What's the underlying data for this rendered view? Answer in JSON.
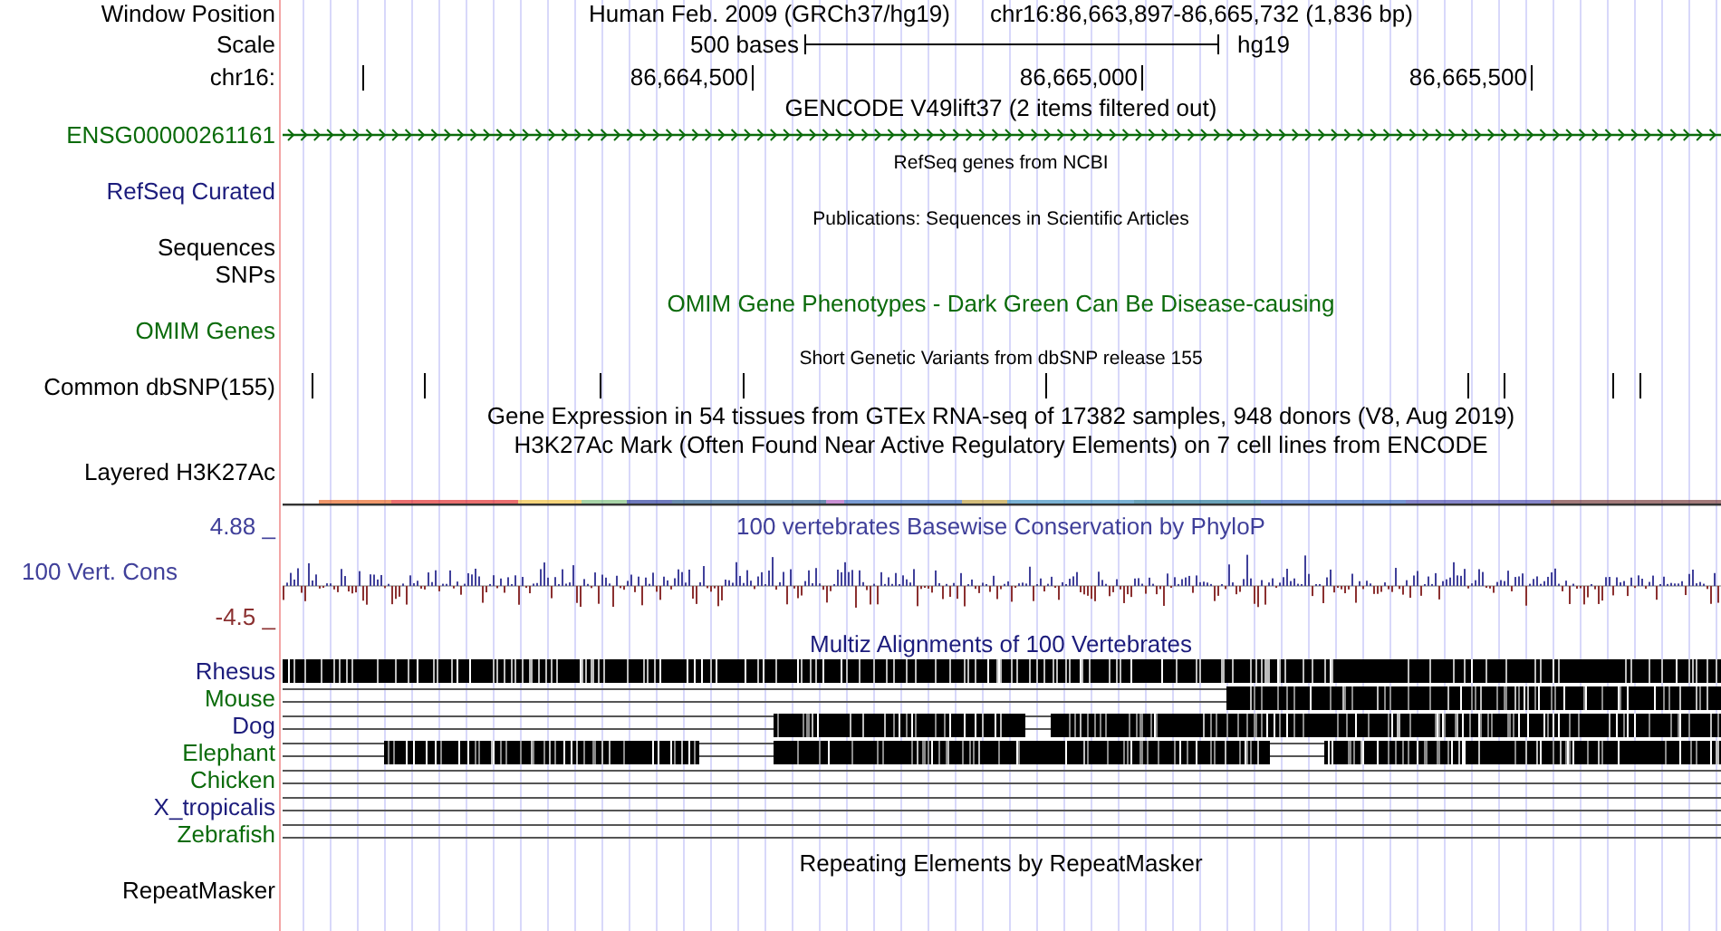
{
  "position": {
    "label": "Window Position",
    "assembly": "Human Feb. 2009 (GRCh37/hg19)",
    "range": "chr16:86,663,897-86,665,732 (1,836 bp)"
  },
  "scale": {
    "label": "Scale",
    "length": "500 bases",
    "assembly": "hg19"
  },
  "ruler": {
    "label": "chr16:",
    "ticks": [
      "86,664,500",
      "86,665,000",
      "86,665,500"
    ]
  },
  "tracks": [
    {
      "kind": "gene",
      "small": false,
      "title": "GENCODE V49lift37 (2 items filtered out)",
      "color": "#000000",
      "items": [
        {
          "name": "ENSG00000261161",
          "color": "#0b6b0b"
        }
      ]
    },
    {
      "kind": "empty",
      "small": true,
      "title": "RefSeq genes from NCBI",
      "color": "#000000",
      "labels": [
        {
          "text": "RefSeq Curated",
          "color": "#1c1c7c"
        }
      ]
    },
    {
      "kind": "empty",
      "small": true,
      "title": "Publications: Sequences in Scientific Articles",
      "color": "#000000",
      "labels": [
        {
          "text": "Sequences",
          "color": "#000000"
        },
        {
          "text": "SNPs",
          "color": "#000000"
        }
      ]
    },
    {
      "kind": "empty",
      "small": false,
      "title": "OMIM Gene Phenotypes - Dark Green Can Be Disease-causing",
      "color": "#0b6b0b",
      "labels": [
        {
          "text": "OMIM Genes",
          "color": "#0b6b0b"
        }
      ]
    },
    {
      "kind": "snp",
      "small": true,
      "title": "Short Genetic Variants from dbSNP release 155",
      "color": "#000000",
      "labels": [
        {
          "text": "Common dbSNP(155)",
          "color": "#000000"
        }
      ]
    },
    {
      "kind": "empty",
      "small": false,
      "title": "Gene Expression in 54 tissues from GTEx RNA-seq of 17382 samples, 948 donors (V8, Aug 2019)",
      "color": "#000000"
    },
    {
      "kind": "layered",
      "small": false,
      "title": "H3K27Ac Mark (Often Found Near Active Regulatory Elements) on 7 cell lines from ENCODE",
      "color": "#000000",
      "labels": [
        {
          "text": "Layered H3K27Ac",
          "color": "#000000"
        }
      ]
    },
    {
      "kind": "wiggle",
      "small": false,
      "title": "100 vertebrates Basewise Conservation by PhyloP",
      "color": "#40409a",
      "labels": [
        {
          "text": "100 Vert. Cons",
          "color": "#40409a"
        }
      ],
      "max": {
        "text": "4.88 _",
        "color": "#40409a"
      },
      "min": {
        "text": "-4.5 _",
        "color": "#8b3030"
      }
    },
    {
      "kind": "multiz",
      "small": false,
      "title": "Multiz Alignments of 100 Vertebrates",
      "color": "#1c1c7c",
      "species": [
        {
          "name": "Rhesus",
          "color": "#1c1c7c"
        },
        {
          "name": "Mouse",
          "color": "#0b6b0b"
        },
        {
          "name": "Dog",
          "color": "#1c1c7c"
        },
        {
          "name": "Elephant",
          "color": "#0b6b0b"
        },
        {
          "name": "Chicken",
          "color": "#0b6b0b"
        },
        {
          "name": "X_tropicalis",
          "color": "#1c1c7c"
        },
        {
          "name": "Zebrafish",
          "color": "#0b6b0b"
        }
      ]
    },
    {
      "kind": "empty",
      "small": false,
      "title": "Repeating Elements by RepeatMasker",
      "color": "#000000",
      "labels": [
        {
          "text": "RepeatMasker",
          "color": "#000000"
        }
      ]
    }
  ]
}
